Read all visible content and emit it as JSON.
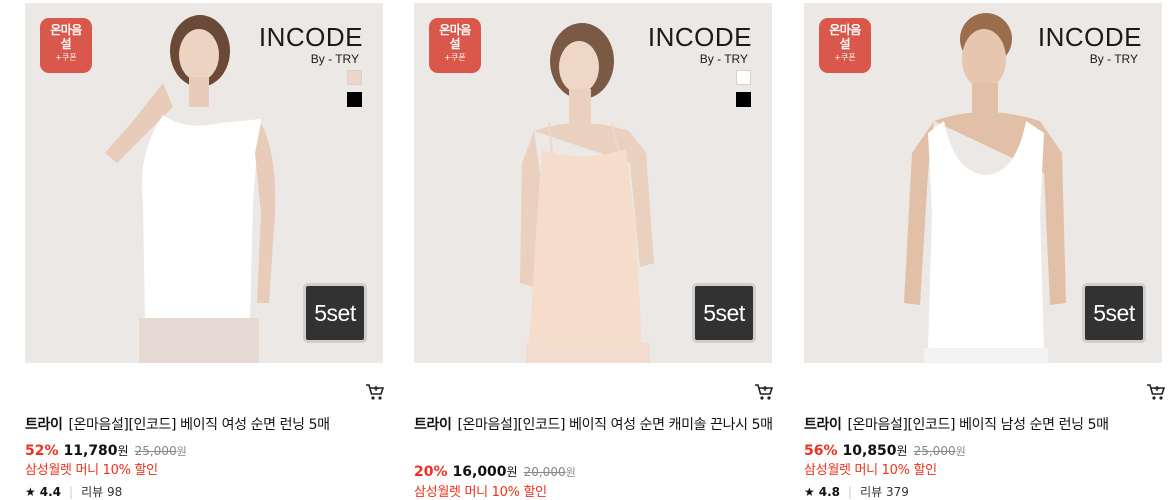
{
  "products": [
    {
      "badge": {
        "line1": "온마음",
        "line2": "설",
        "line3": "+쿠폰"
      },
      "brand_logo": "INCODE",
      "brand_sub": "By - TRY",
      "set_label": "5set",
      "seller": "트라이",
      "title": "[온마음설][인코드] 베이직 여성 순면 런닝 5매",
      "discount": "52%",
      "price": "11,780",
      "won": "원",
      "original_price": "25,000",
      "original_won": "원",
      "promo": "삼성월렛 머니 10% 할인",
      "rating": "4.4",
      "review_label": "리뷰",
      "review_count": "98",
      "colors": [
        "#ecd6cc",
        "#000000"
      ]
    },
    {
      "badge": {
        "line1": "온마음",
        "line2": "설",
        "line3": "+쿠폰"
      },
      "brand_logo": "INCODE",
      "brand_sub": "By - TRY",
      "set_label": "5set",
      "seller": "트라이",
      "title": "[온마음설][인코드] 베이직 여성 순면 캐미솔 끈나시 5매",
      "discount": "20%",
      "price": "16,000",
      "won": "원",
      "original_price": "20,000",
      "original_won": "원",
      "promo": "삼성월렛 머니 10% 할인",
      "colors": [
        "#ffffff",
        "#000000"
      ]
    },
    {
      "badge": {
        "line1": "온마음",
        "line2": "설",
        "line3": "+쿠폰"
      },
      "brand_logo": "INCODE",
      "brand_sub": "By - TRY",
      "set_label": "5set",
      "seller": "트라이",
      "title": "[온마음설][인코드] 베이직 남성 순면 런닝 5매",
      "discount": "56%",
      "price": "10,850",
      "won": "원",
      "original_price": "25,000",
      "original_won": "원",
      "promo": "삼성월렛 머니 10% 할인",
      "rating": "4.8",
      "review_label": "리뷰",
      "review_count": "379"
    }
  ],
  "icons": {
    "cart": "cart-icon",
    "star": "star-icon"
  },
  "colors": {
    "discount": "#f0301e",
    "badge": "#d9574b",
    "set_badge": "#323232"
  }
}
